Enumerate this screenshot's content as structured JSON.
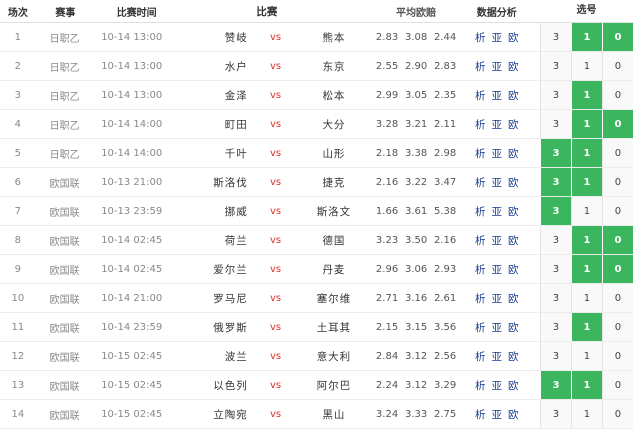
{
  "header": {
    "idx": "场次",
    "league": "赛事",
    "time": "比赛时间",
    "match": "比赛",
    "odds": "平均欧赔",
    "analysis": "数据分析",
    "pick": "选号"
  },
  "vs_label": "vs",
  "analysis_links": [
    "析",
    "亚",
    "欧"
  ],
  "colors": {
    "selected": "#3bb55e",
    "vs": "#e0302a",
    "link": "#1b3f8f"
  },
  "rows": [
    {
      "idx": "1",
      "league": "日职乙",
      "time": "10-14 13:00",
      "home": "赞岐",
      "away": "熊本",
      "odds": [
        "2.83",
        "3.08",
        "2.44"
      ],
      "picks": [
        {
          "v": "3",
          "s": false
        },
        {
          "v": "1",
          "s": true
        },
        {
          "v": "0",
          "s": true
        }
      ]
    },
    {
      "idx": "2",
      "league": "日职乙",
      "time": "10-14 13:00",
      "home": "水户",
      "away": "东京",
      "odds": [
        "2.55",
        "2.90",
        "2.83"
      ],
      "picks": [
        {
          "v": "3",
          "s": false
        },
        {
          "v": "1",
          "s": false
        },
        {
          "v": "0",
          "s": false
        }
      ]
    },
    {
      "idx": "3",
      "league": "日职乙",
      "time": "10-14 13:00",
      "home": "金泽",
      "away": "松本",
      "odds": [
        "2.99",
        "3.05",
        "2.35"
      ],
      "picks": [
        {
          "v": "3",
          "s": false
        },
        {
          "v": "1",
          "s": true
        },
        {
          "v": "0",
          "s": false
        }
      ]
    },
    {
      "idx": "4",
      "league": "日职乙",
      "time": "10-14 14:00",
      "home": "町田",
      "away": "大分",
      "odds": [
        "3.28",
        "3.21",
        "2.11"
      ],
      "picks": [
        {
          "v": "3",
          "s": false
        },
        {
          "v": "1",
          "s": true
        },
        {
          "v": "0",
          "s": true
        }
      ]
    },
    {
      "idx": "5",
      "league": "日职乙",
      "time": "10-14 14:00",
      "home": "千叶",
      "away": "山形",
      "odds": [
        "2.18",
        "3.38",
        "2.98"
      ],
      "picks": [
        {
          "v": "3",
          "s": true
        },
        {
          "v": "1",
          "s": true
        },
        {
          "v": "0",
          "s": false
        }
      ]
    },
    {
      "idx": "6",
      "league": "欧国联",
      "time": "10-13 21:00",
      "home": "斯洛伐",
      "away": "捷克",
      "odds": [
        "2.16",
        "3.22",
        "3.47"
      ],
      "picks": [
        {
          "v": "3",
          "s": true
        },
        {
          "v": "1",
          "s": true
        },
        {
          "v": "0",
          "s": false
        }
      ]
    },
    {
      "idx": "7",
      "league": "欧国联",
      "time": "10-13 23:59",
      "home": "挪威",
      "away": "斯洛文",
      "odds": [
        "1.66",
        "3.61",
        "5.38"
      ],
      "picks": [
        {
          "v": "3",
          "s": true
        },
        {
          "v": "1",
          "s": false
        },
        {
          "v": "0",
          "s": false
        }
      ]
    },
    {
      "idx": "8",
      "league": "欧国联",
      "time": "10-14 02:45",
      "home": "荷兰",
      "away": "德国",
      "odds": [
        "3.23",
        "3.50",
        "2.16"
      ],
      "picks": [
        {
          "v": "3",
          "s": false
        },
        {
          "v": "1",
          "s": true
        },
        {
          "v": "0",
          "s": true
        }
      ]
    },
    {
      "idx": "9",
      "league": "欧国联",
      "time": "10-14 02:45",
      "home": "爱尔兰",
      "away": "丹麦",
      "odds": [
        "2.96",
        "3.06",
        "2.93"
      ],
      "picks": [
        {
          "v": "3",
          "s": false
        },
        {
          "v": "1",
          "s": true
        },
        {
          "v": "0",
          "s": true
        }
      ]
    },
    {
      "idx": "10",
      "league": "欧国联",
      "time": "10-14 21:00",
      "home": "罗马尼",
      "away": "塞尔维",
      "odds": [
        "2.71",
        "3.16",
        "2.61"
      ],
      "picks": [
        {
          "v": "3",
          "s": false
        },
        {
          "v": "1",
          "s": false
        },
        {
          "v": "0",
          "s": false
        }
      ]
    },
    {
      "idx": "11",
      "league": "欧国联",
      "time": "10-14 23:59",
      "home": "俄罗斯",
      "away": "土耳其",
      "odds": [
        "2.15",
        "3.15",
        "3.56"
      ],
      "picks": [
        {
          "v": "3",
          "s": false
        },
        {
          "v": "1",
          "s": true
        },
        {
          "v": "0",
          "s": false
        }
      ]
    },
    {
      "idx": "12",
      "league": "欧国联",
      "time": "10-15 02:45",
      "home": "波兰",
      "away": "意大利",
      "odds": [
        "2.84",
        "3.12",
        "2.56"
      ],
      "picks": [
        {
          "v": "3",
          "s": false
        },
        {
          "v": "1",
          "s": false
        },
        {
          "v": "0",
          "s": false
        }
      ]
    },
    {
      "idx": "13",
      "league": "欧国联",
      "time": "10-15 02:45",
      "home": "以色列",
      "away": "阿尔巴",
      "odds": [
        "2.24",
        "3.12",
        "3.29"
      ],
      "picks": [
        {
          "v": "3",
          "s": true
        },
        {
          "v": "1",
          "s": true
        },
        {
          "v": "0",
          "s": false
        }
      ]
    },
    {
      "idx": "14",
      "league": "欧国联",
      "time": "10-15 02:45",
      "home": "立陶宛",
      "away": "黑山",
      "odds": [
        "3.24",
        "3.33",
        "2.75"
      ],
      "picks": [
        {
          "v": "3",
          "s": false
        },
        {
          "v": "1",
          "s": false
        },
        {
          "v": "0",
          "s": false
        }
      ]
    }
  ]
}
